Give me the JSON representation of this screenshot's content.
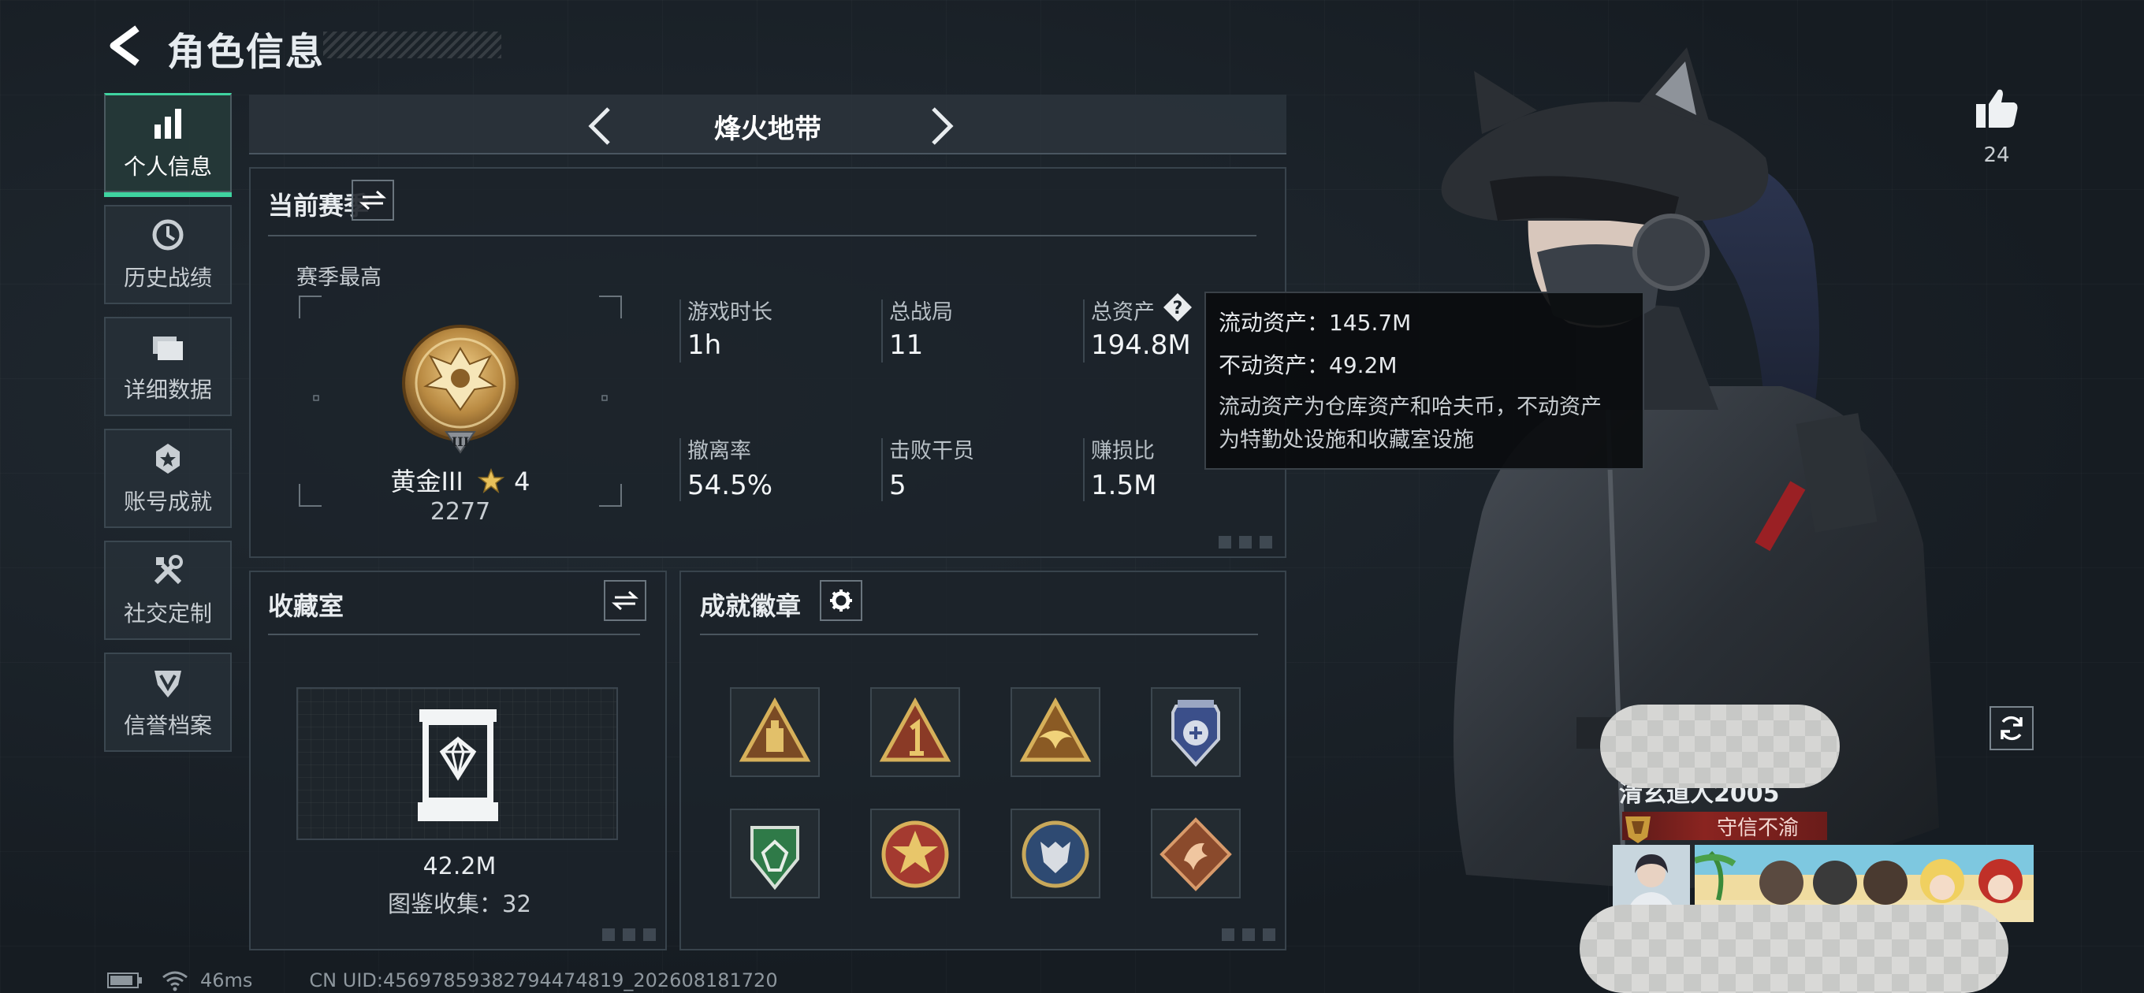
{
  "header": {
    "title": "角色信息"
  },
  "sidebar": {
    "items": [
      {
        "label": "个人信息",
        "icon": "bar-chart-icon",
        "active": true
      },
      {
        "label": "历史战绩",
        "icon": "history-clock-icon",
        "active": false
      },
      {
        "label": "详细数据",
        "icon": "folder-icon",
        "active": false
      },
      {
        "label": "账号成就",
        "icon": "achievement-icon",
        "active": false
      },
      {
        "label": "社交定制",
        "icon": "tools-icon",
        "active": false
      },
      {
        "label": "信誉档案",
        "icon": "credit-shield-icon",
        "active": false
      }
    ]
  },
  "mode": {
    "title": "烽火地带"
  },
  "season": {
    "title": "当前赛季",
    "best_label": "赛季最高",
    "rank_name": "黄金III",
    "rank_stars": "4",
    "rank_score": "2277",
    "rank_badge_numeral": "III",
    "stats": [
      {
        "label": "游戏时长",
        "value": "1h"
      },
      {
        "label": "总战局",
        "value": "11"
      },
      {
        "label": "总资产",
        "value": "194.8M"
      },
      {
        "label": "撤离率",
        "value": "54.5%"
      },
      {
        "label": "击败干员",
        "value": "5"
      },
      {
        "label": "赚损比",
        "value": "1.5M"
      }
    ]
  },
  "tooltip": {
    "liquid": "流动资产：145.7M",
    "fixed": "不动资产：49.2M",
    "desc_line1": "流动资产为仓库资产和哈夫币，不动资产",
    "desc_line2": "为特勤处设施和收藏室设施"
  },
  "collection": {
    "title": "收藏室",
    "value": "42.2M",
    "catalog": "图鉴收集：32"
  },
  "badges": {
    "title": "成就徽章",
    "items": [
      {
        "icon": "triangle-tower-badge-icon",
        "color": "#c9a24a"
      },
      {
        "icon": "triangle-number-one-badge-icon",
        "color": "#c9a24a"
      },
      {
        "icon": "triangle-bird-badge-icon",
        "color": "#c9a24a"
      },
      {
        "icon": "blue-shield-badge-icon",
        "color": "#4a5f9a"
      },
      {
        "icon": "green-shield-badge-icon",
        "color": "#3f8a55"
      },
      {
        "icon": "red-star-medal-icon",
        "color": "#b8463a"
      },
      {
        "icon": "wolf-medal-icon",
        "color": "#3a5a86"
      },
      {
        "icon": "copper-dragon-badge-icon",
        "color": "#a05a38"
      }
    ]
  },
  "player": {
    "likes": "24",
    "name": "清玄道人2005",
    "honor_title": "守信不渝"
  },
  "footer": {
    "ping": "46ms",
    "uid": "CN UID:4569785938279447481​9_202608181720"
  },
  "colors": {
    "accent": "#3fd3a0",
    "background": "#1a2128",
    "honor_red": "#8a2420"
  }
}
